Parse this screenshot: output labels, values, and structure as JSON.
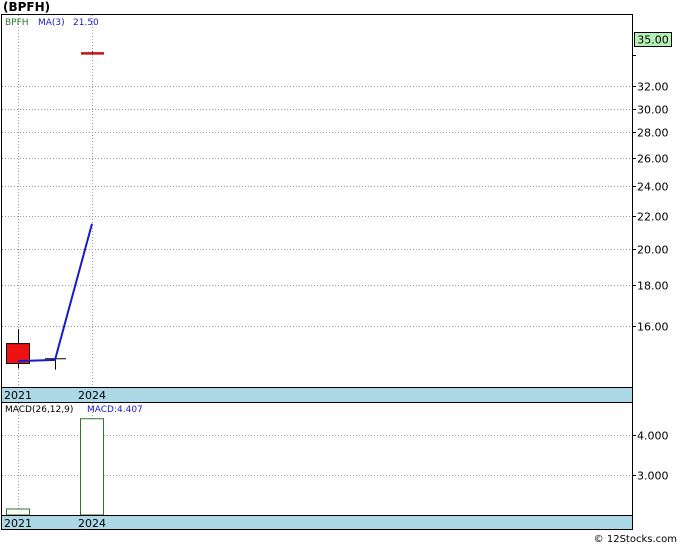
{
  "title": "(BPFH)",
  "legend": {
    "ticker": "BPFH",
    "ma_label": "MA(3)",
    "ma_value": "21.50"
  },
  "macd_legend": {
    "name": "MACD(26,12,9)",
    "value_label": "MACD:4.407"
  },
  "last_price_badge": "35.00",
  "copyright": "© 12Stocks.com",
  "colors": {
    "ticker": "#2a7a2a",
    "ma_line": "#1a1acc",
    "down_candle": "#ee1111",
    "last_candle": "#cc1111",
    "price_badge_bg": "#b6f0b6",
    "axis_strip": "#add8e6",
    "macd_bar_stroke": "#2a7a2a"
  },
  "chart_data": [
    {
      "type": "candlestick",
      "title": "(BPFH)",
      "x_tick_labels": [
        "2021",
        "2024"
      ],
      "y_tick_labels": [
        "16.00",
        "18.00",
        "20.00",
        "22.00",
        "24.00",
        "26.00",
        "28.00",
        "30.00",
        "32.00",
        "35.00"
      ],
      "y_scale": "log",
      "ylim": [
        13.8,
        37.5
      ],
      "grid": true,
      "candles": [
        {
          "x": "2021",
          "open": 15.2,
          "high": 15.85,
          "low": 14.15,
          "close": 14.35,
          "direction": "down"
        },
        {
          "x": "",
          "open": 14.55,
          "high": 14.6,
          "low": 14.1,
          "close": 14.3,
          "direction": "flat"
        },
        {
          "x": "2024",
          "open": 35.2,
          "high": 35.4,
          "low": 35.05,
          "close": 35.2,
          "direction": "flat"
        }
      ],
      "series": [
        {
          "name": "MA(3)",
          "type": "line",
          "x": [
            "2021",
            "",
            "2024"
          ],
          "values": [
            14.45,
            14.5,
            21.5
          ]
        }
      ]
    },
    {
      "type": "bar",
      "title": "MACD(26,12,9)",
      "x_tick_labels": [
        "2021",
        "2024"
      ],
      "y_tick_labels": [
        "3.000",
        "4.000"
      ],
      "ylim": [
        2.0,
        4.8
      ],
      "grid": true,
      "bars": [
        {
          "x": "2021",
          "value": 2.15
        },
        {
          "x": "2024",
          "value": 4.407
        }
      ]
    }
  ]
}
